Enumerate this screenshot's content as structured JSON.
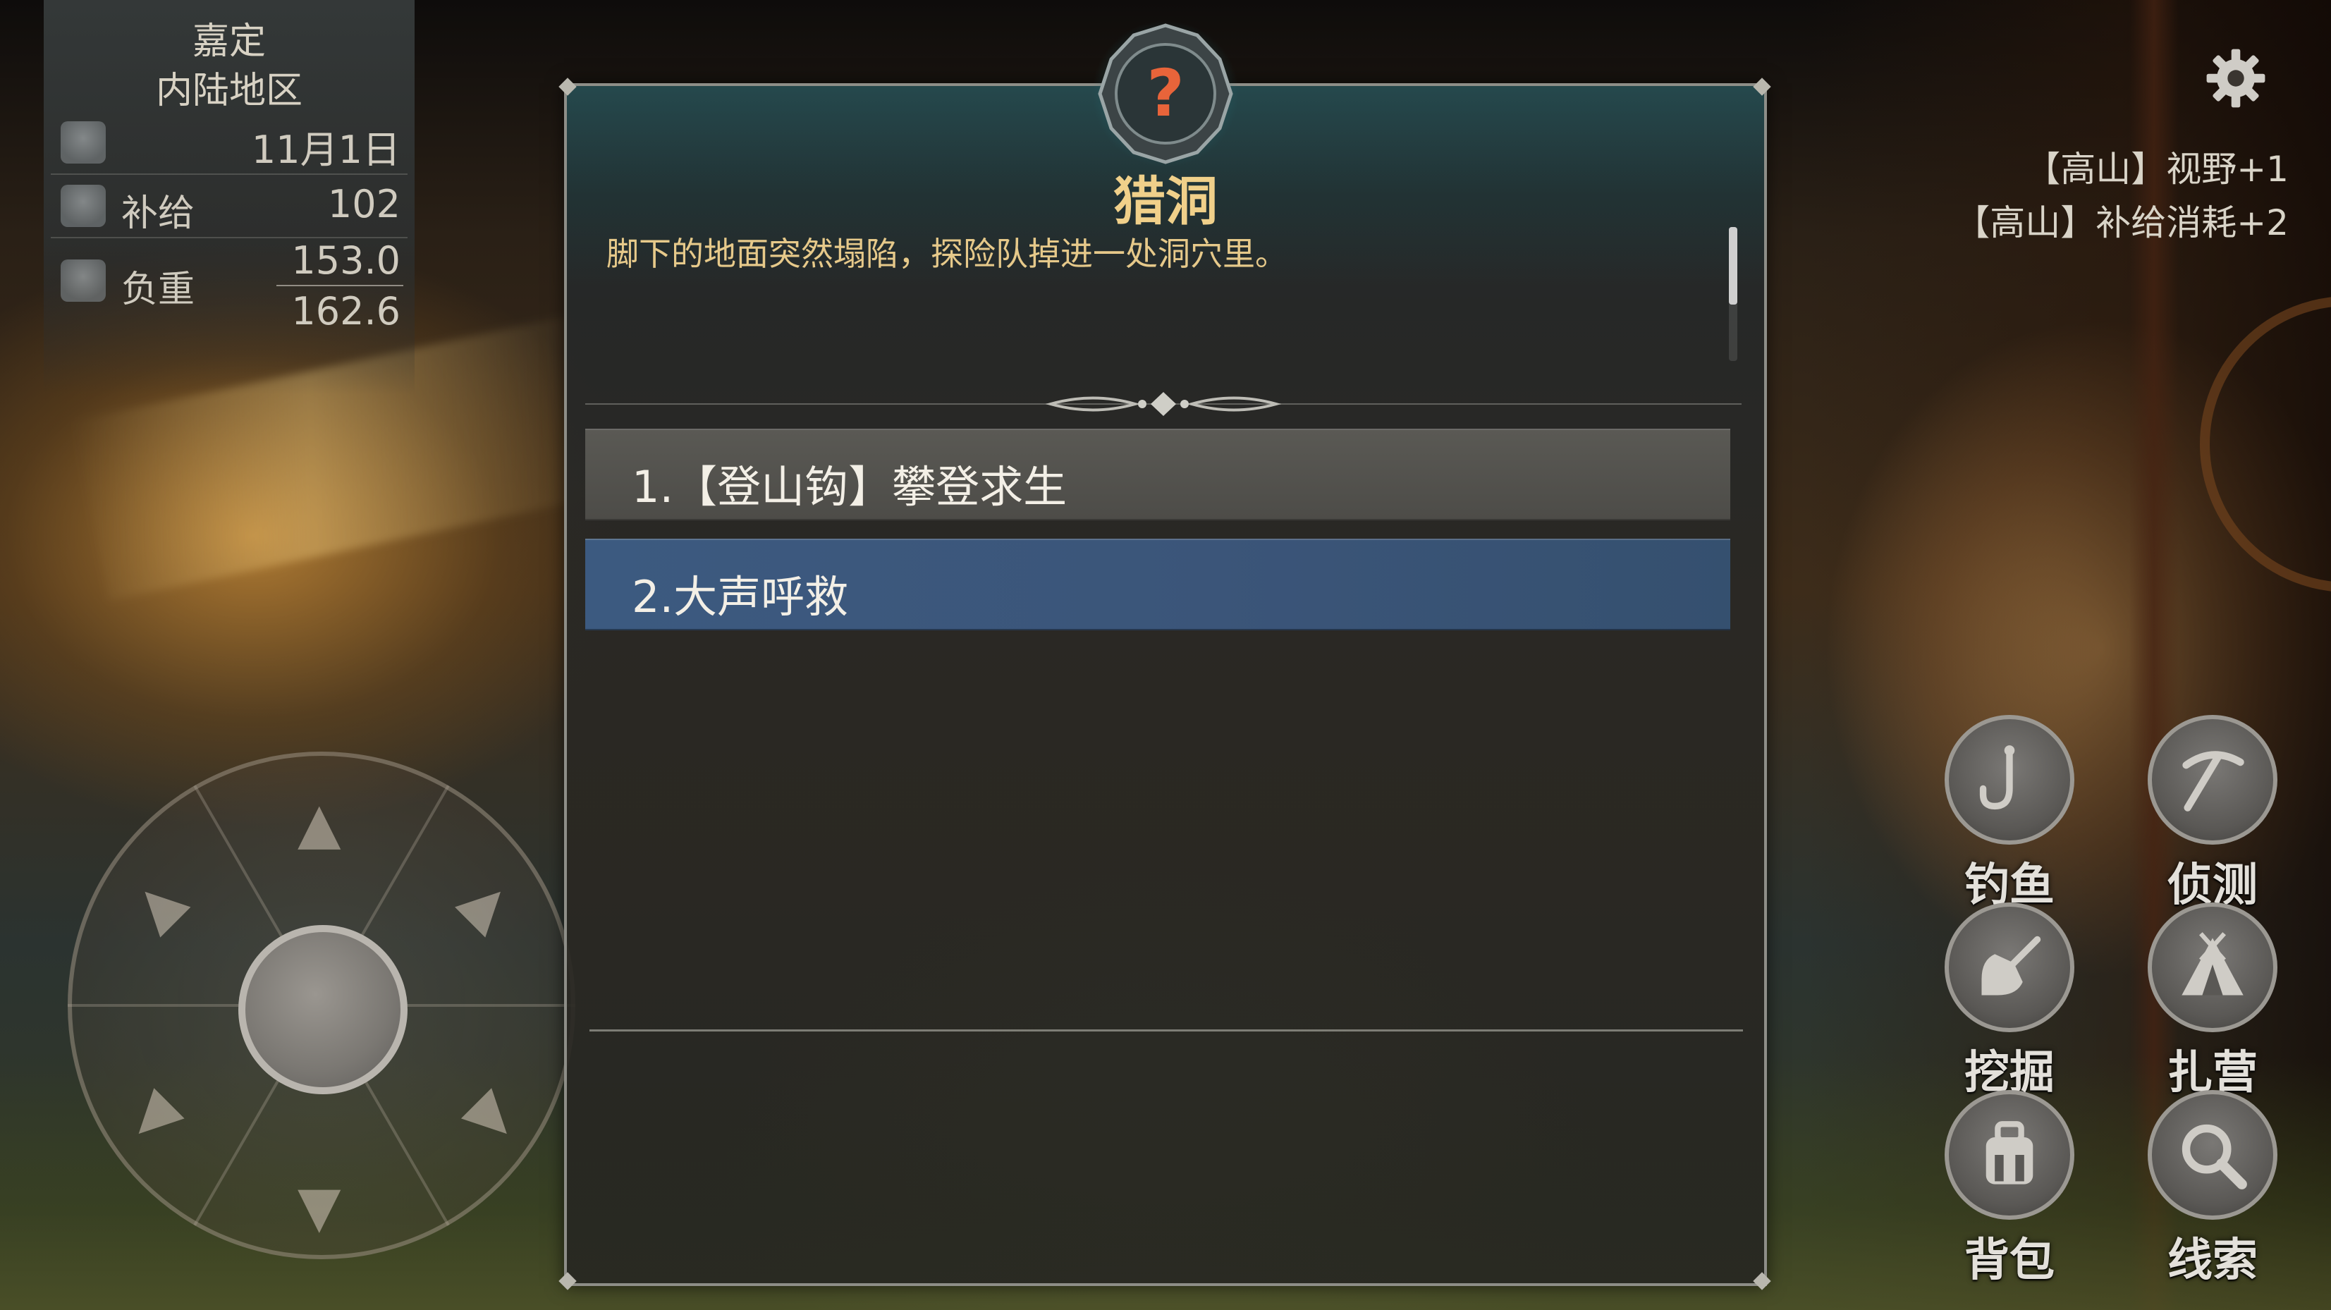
{
  "location": {
    "name": "嘉定",
    "region": "内陆地区"
  },
  "stats": {
    "date": "11月1日",
    "supply_label": "补给",
    "supply_value": "102",
    "load_label": "负重",
    "load_current": "153.0",
    "load_max": "162.6"
  },
  "terrain_effects": [
    "【高山】视野+1",
    "【高山】补给消耗+2"
  ],
  "event": {
    "icon_glyph": "?",
    "title": "猎洞",
    "description": "脚下的地面突然塌陷，探险队掉进一处洞穴里。",
    "options": [
      {
        "label": "1.【登山钩】攀登求生",
        "selected": false
      },
      {
        "label": "2.大声呼救",
        "selected": true
      }
    ]
  },
  "actions": [
    {
      "label": "钓鱼",
      "icon": "fishing-hook-icon"
    },
    {
      "label": "侦测",
      "icon": "pickaxe-icon"
    },
    {
      "label": "挖掘",
      "icon": "shovel-icon"
    },
    {
      "label": "扎营",
      "icon": "tent-icon"
    },
    {
      "label": "背包",
      "icon": "backpack-icon"
    },
    {
      "label": "线索",
      "icon": "magnifier-icon"
    }
  ],
  "colors": {
    "title": "#f0d08a",
    "description": "#e6c98a",
    "selected_option": "#3c5a80",
    "option": "#5a5954",
    "badge_question": "#e8643a"
  }
}
